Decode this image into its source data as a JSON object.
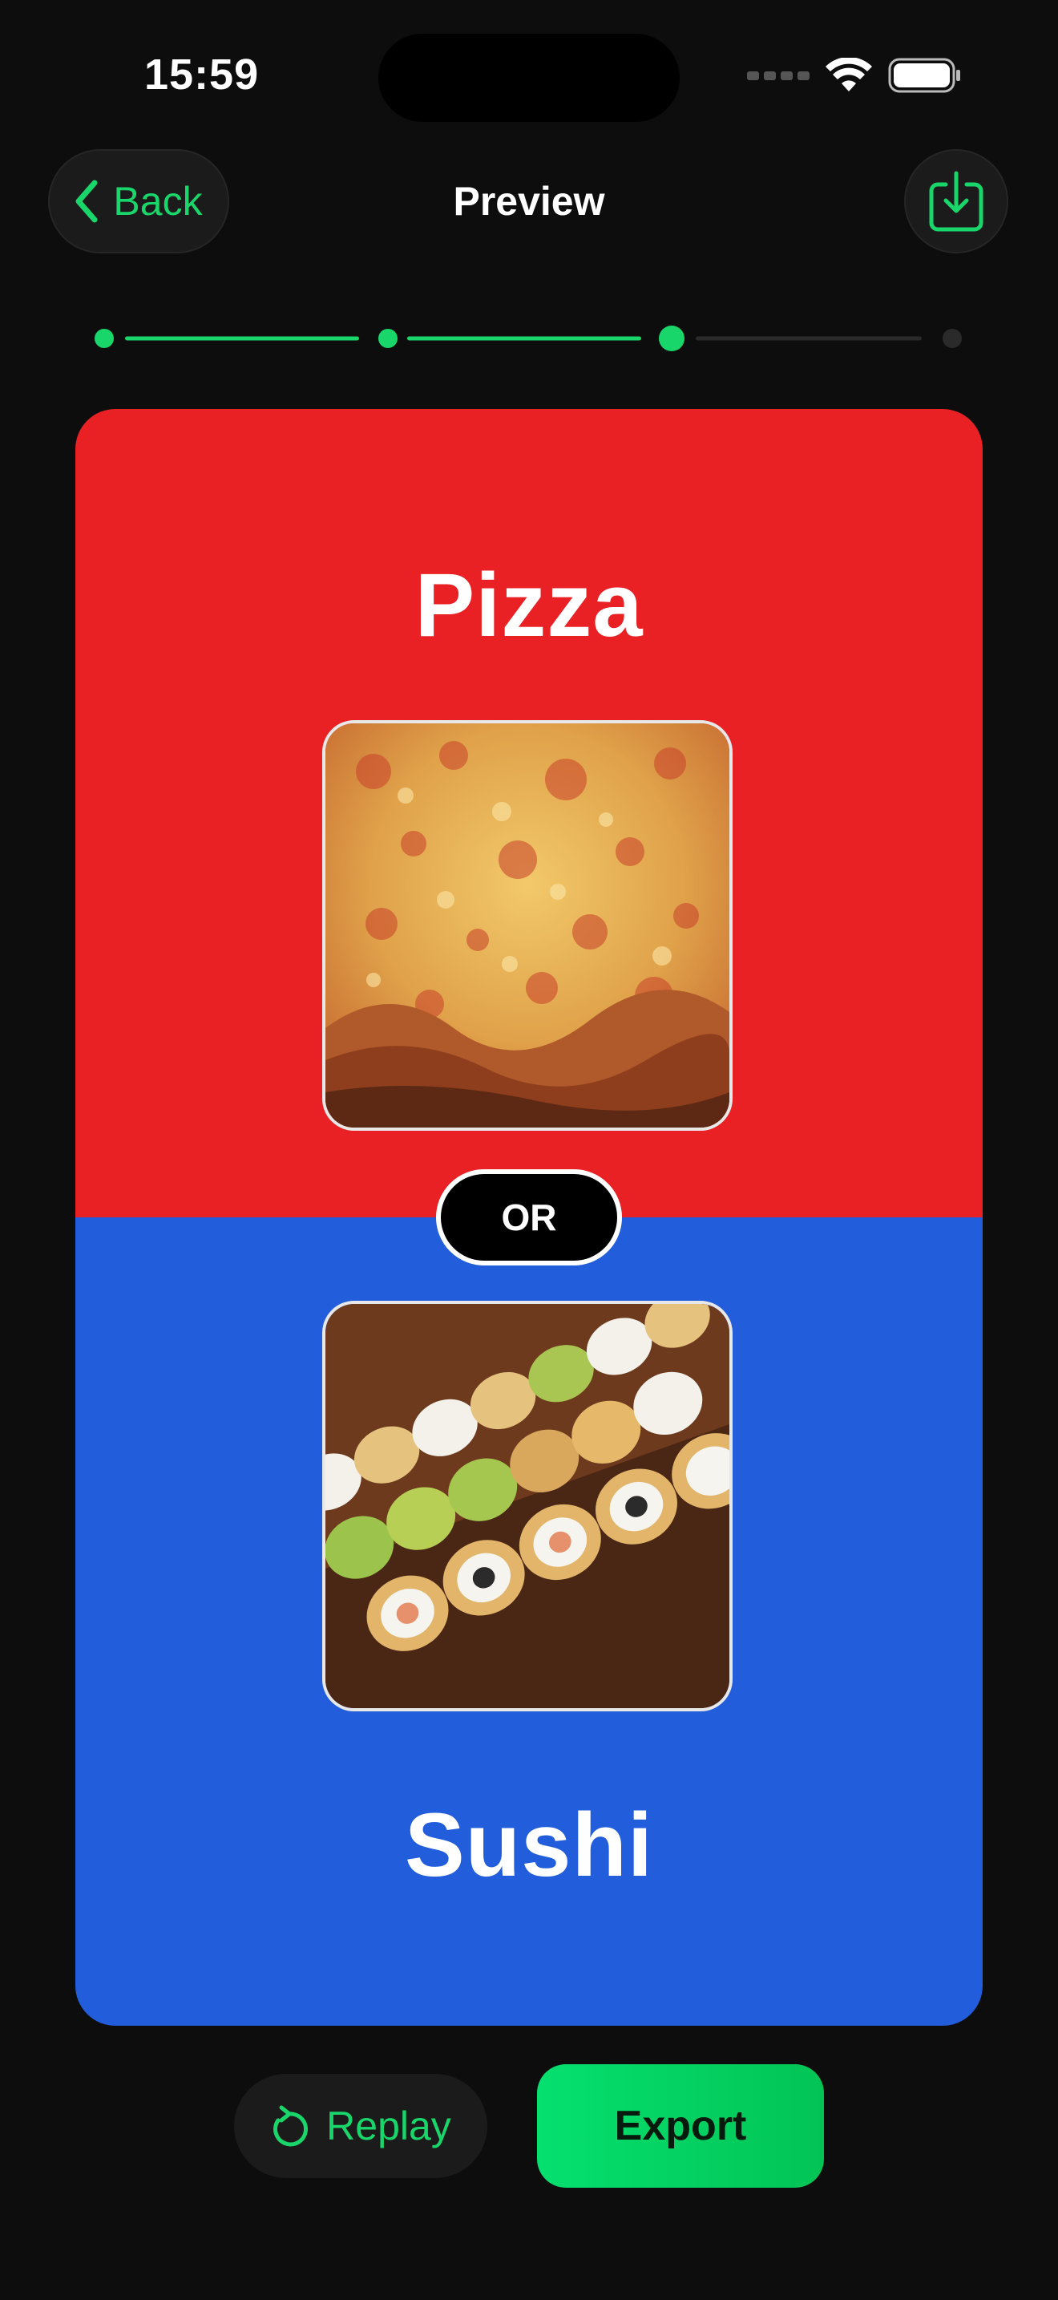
{
  "status_bar": {
    "time": "15:59"
  },
  "nav": {
    "back_label": "Back",
    "title": "Preview",
    "download_icon": "download-tray-icon"
  },
  "progress": {
    "steps_total": 4,
    "current_step": 3
  },
  "card": {
    "option_a": {
      "title": "Pizza",
      "image": "pizza-photo",
      "background_color": "#E92124"
    },
    "option_b": {
      "title": "Sushi",
      "image": "sushi-photo",
      "background_color": "#225DDC"
    },
    "divider_label": "OR"
  },
  "actions": {
    "replay_label": "Replay",
    "export_label": "Export"
  },
  "colors": {
    "accent": "#19D66B",
    "background": "#0D0D0D",
    "surface": "#1B1B1B"
  }
}
